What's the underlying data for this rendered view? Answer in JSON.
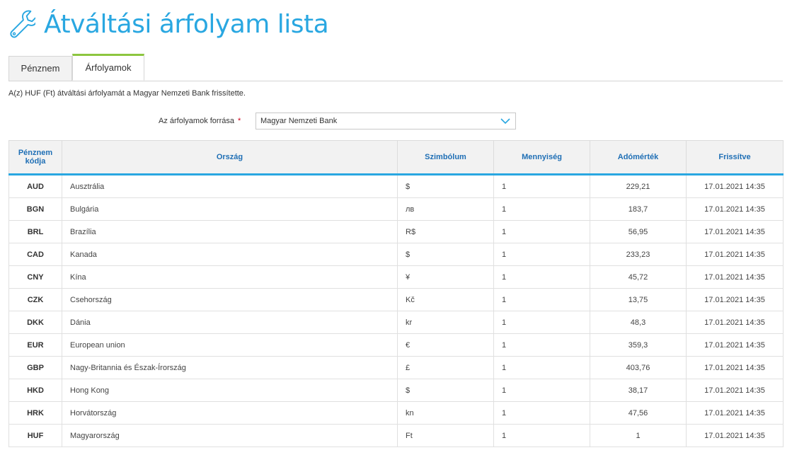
{
  "page": {
    "title": "Átváltási árfolyam lista",
    "icon": "wrench-icon",
    "accent": "#29a7e1"
  },
  "tabs": [
    {
      "label": "Pénznem",
      "active": false
    },
    {
      "label": "Árfolyamok",
      "active": true
    }
  ],
  "notice": "A(z) HUF (Ft) átváltási árfolyamát a Magyar Nemzeti Bank frissítette.",
  "source": {
    "label": "Az árfolyamok forrása",
    "required_mark": "*",
    "value": "Magyar Nemzeti Bank"
  },
  "table": {
    "headers": [
      "Pénznem kódja",
      "Ország",
      "Szimbólum",
      "Mennyiség",
      "Adómérték",
      "Frissítve"
    ],
    "rows": [
      [
        "AUD",
        "Ausztrália",
        "$",
        "1",
        "229,21",
        "17.01.2021 14:35"
      ],
      [
        "BGN",
        "Bulgária",
        "лв",
        "1",
        "183,7",
        "17.01.2021 14:35"
      ],
      [
        "BRL",
        "Brazília",
        "R$",
        "1",
        "56,95",
        "17.01.2021 14:35"
      ],
      [
        "CAD",
        "Kanada",
        "$",
        "1",
        "233,23",
        "17.01.2021 14:35"
      ],
      [
        "CNY",
        "Kína",
        "¥",
        "1",
        "45,72",
        "17.01.2021 14:35"
      ],
      [
        "CZK",
        "Csehország",
        "Kč",
        "1",
        "13,75",
        "17.01.2021 14:35"
      ],
      [
        "DKK",
        "Dánia",
        "kr",
        "1",
        "48,3",
        "17.01.2021 14:35"
      ],
      [
        "EUR",
        "European union",
        "€",
        "1",
        "359,3",
        "17.01.2021 14:35"
      ],
      [
        "GBP",
        "Nagy-Britannia és Észak-Írország",
        "£",
        "1",
        "403,76",
        "17.01.2021 14:35"
      ],
      [
        "HKD",
        "Hong Kong",
        "$",
        "1",
        "38,17",
        "17.01.2021 14:35"
      ],
      [
        "HRK",
        "Horvátország",
        "kn",
        "1",
        "47,56",
        "17.01.2021 14:35"
      ],
      [
        "HUF",
        "Magyarország",
        "Ft",
        "1",
        "1",
        "17.01.2021 14:35"
      ]
    ]
  }
}
